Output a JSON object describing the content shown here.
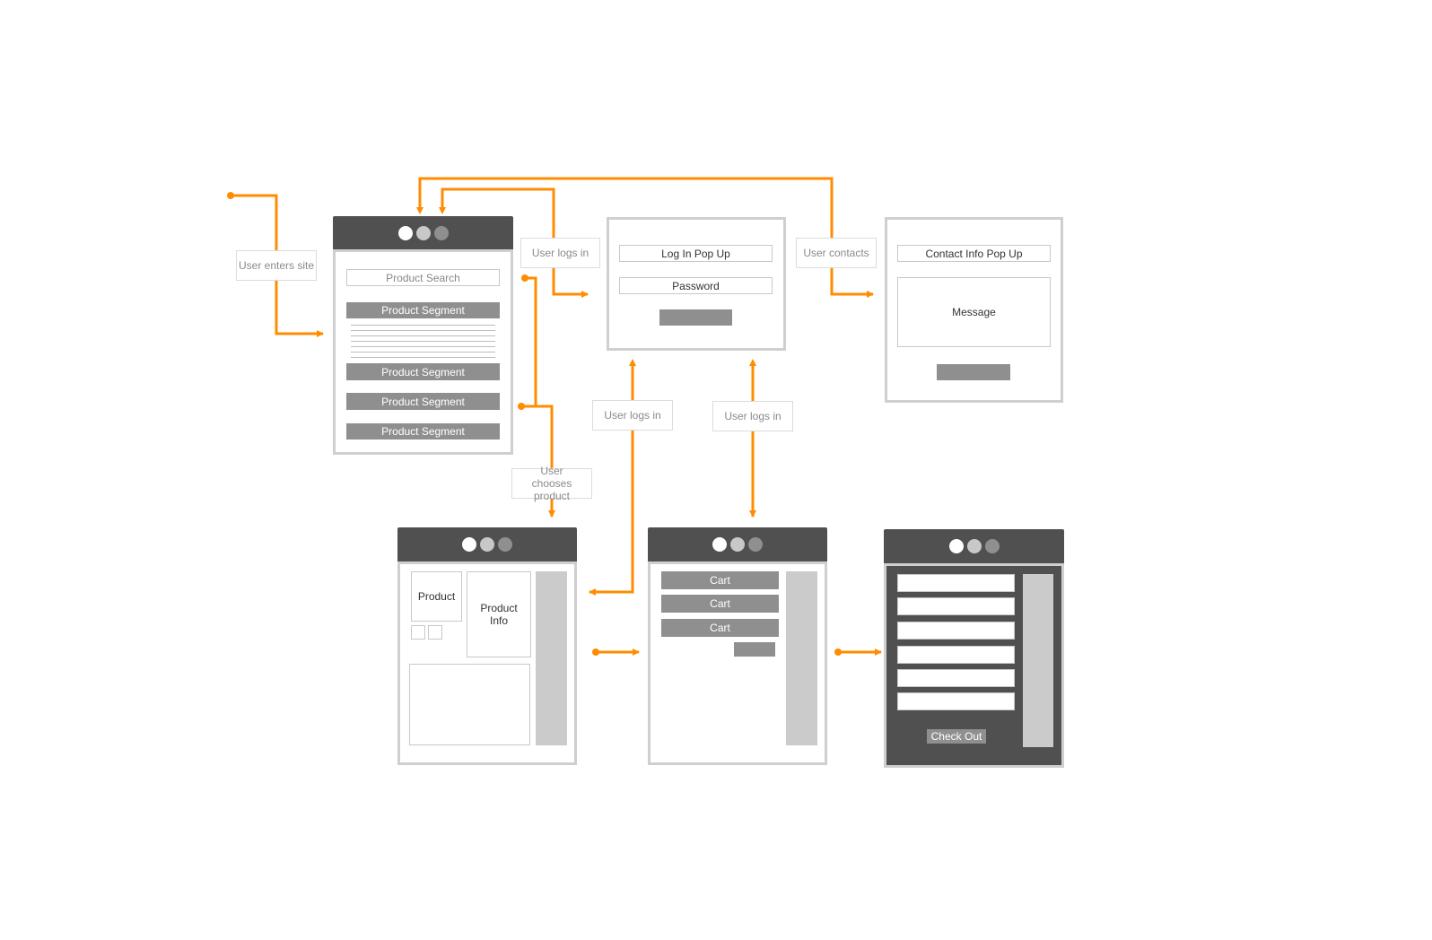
{
  "colors": {
    "flow": "#FF8C00",
    "window_header": "#505050",
    "block": "#8f8f8f",
    "sidebar": "#cbcbcb"
  },
  "labels": {
    "user_enters_site": "User enters site",
    "user_logs_in_top": "User logs in",
    "user_contacts": "User contacts",
    "user_logs_in_mid1": "User logs in",
    "user_logs_in_mid2": "User logs in",
    "user_chooses_product": "User chooses product"
  },
  "home": {
    "search": "Product Search",
    "segments": [
      "Product Segment",
      "Product Segment",
      "Product Segment",
      "Product Segment"
    ]
  },
  "login": {
    "field1": "Log In Pop Up",
    "field2": "Password"
  },
  "contact": {
    "field1": "Contact Info Pop Up",
    "message": "Message"
  },
  "product": {
    "image": "Product",
    "info": "Product Info"
  },
  "cart": {
    "items": [
      "Cart",
      "Cart",
      "Cart"
    ]
  },
  "checkout": {
    "button": "Check Out"
  }
}
